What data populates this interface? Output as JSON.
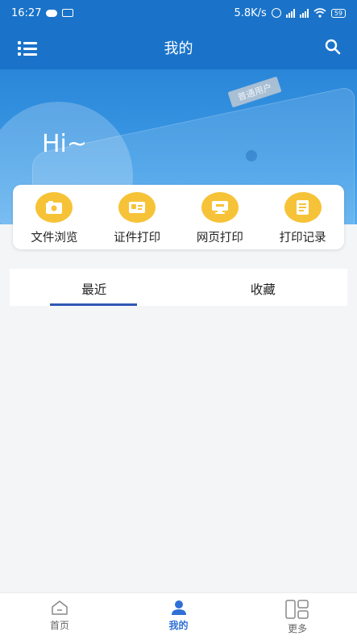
{
  "status_bar": {
    "time": "16:27",
    "network_speed": "5.8K/s",
    "battery": "59"
  },
  "header": {
    "title": "我的"
  },
  "banner": {
    "greeting": "Hi~",
    "card_tag": "普通用户"
  },
  "actions": [
    {
      "label": "文件浏览",
      "icon": "file-browse-icon"
    },
    {
      "label": "证件打印",
      "icon": "id-print-icon"
    },
    {
      "label": "网页打印",
      "icon": "web-print-icon"
    },
    {
      "label": "打印记录",
      "icon": "print-record-icon"
    }
  ],
  "tabs": [
    {
      "label": "最近",
      "active": true
    },
    {
      "label": "收藏",
      "active": false
    }
  ],
  "bottom_nav": [
    {
      "label": "首页",
      "icon": "home-icon",
      "active": false
    },
    {
      "label": "我的",
      "icon": "profile-icon",
      "active": true
    },
    {
      "label": "更多",
      "icon": "more-grid-icon",
      "active": false
    }
  ],
  "colors": {
    "primary": "#1a73c9",
    "accent_yellow": "#f6c338",
    "tab_indicator": "#2f58b5",
    "nav_active": "#2f6fd6"
  }
}
